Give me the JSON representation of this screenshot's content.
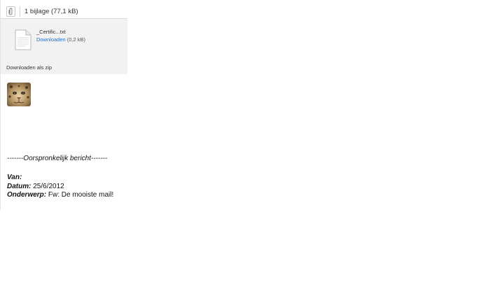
{
  "attachments": {
    "count_label": "1 bijlage (77,1 kB)",
    "file": {
      "name": "_Certific...txt",
      "download_label": "Downloaden",
      "size": "(0,2 kB)"
    },
    "zip_label": "Downloaden als zip"
  },
  "original_message": {
    "separator": "-------Oorspronkelijk bericht-------",
    "van_label": "Van:",
    "datum_label": "Datum:",
    "datum_value": "25/6/2012",
    "onderwerp_label": "Onderwerp:",
    "onderwerp_value": "Fw: De mooiste mail!"
  },
  "colors": {
    "link": "#2a6fc0",
    "panel": "#f2f2f2"
  },
  "icons": {
    "attachment": "paperclip-icon",
    "file": "text-file-icon",
    "avatar": "snow-leopard-avatar"
  }
}
